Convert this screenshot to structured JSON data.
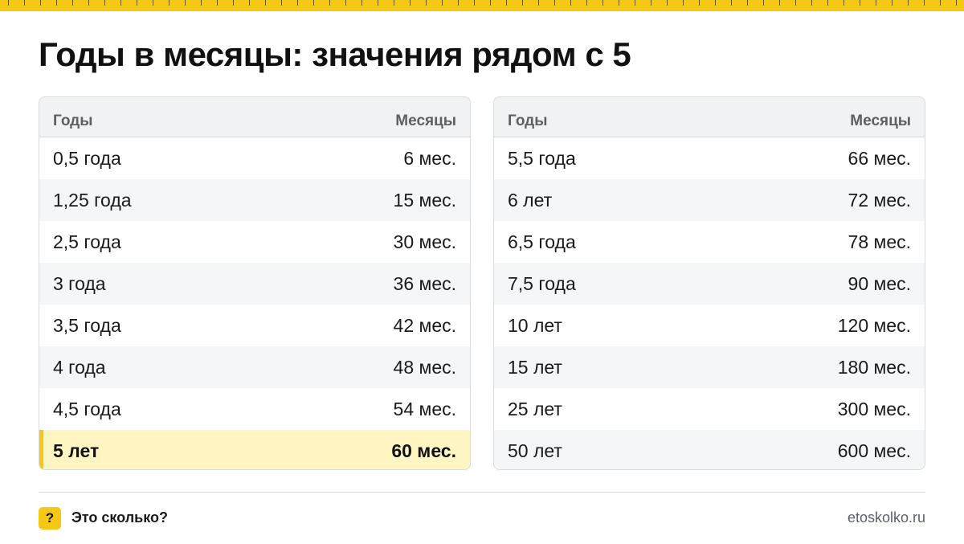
{
  "title": "Годы в месяцы: значения рядом с 5",
  "colors": {
    "accent": "#f5c816",
    "highlight_bg": "#fff5c2",
    "header_bg": "#f1f2f4"
  },
  "tables": [
    {
      "headers": {
        "years": "Годы",
        "months": "Месяцы"
      },
      "rows": [
        {
          "years": "0,5 года",
          "months": "6 мес."
        },
        {
          "years": "1,25 года",
          "months": "15 мес."
        },
        {
          "years": "2,5 года",
          "months": "30 мес."
        },
        {
          "years": "3 года",
          "months": "36 мес."
        },
        {
          "years": "3,5 года",
          "months": "42 мес."
        },
        {
          "years": "4 года",
          "months": "48 мес."
        },
        {
          "years": "4,5 года",
          "months": "54 мес."
        },
        {
          "years": "5 лет",
          "months": "60 мес.",
          "highlighted": true
        }
      ]
    },
    {
      "headers": {
        "years": "Годы",
        "months": "Месяцы"
      },
      "rows": [
        {
          "years": "5,5 года",
          "months": "66 мес."
        },
        {
          "years": "6 лет",
          "months": "72 мес."
        },
        {
          "years": "6,5 года",
          "months": "78 мес."
        },
        {
          "years": "7,5 года",
          "months": "90 мес."
        },
        {
          "years": "10 лет",
          "months": "120 мес."
        },
        {
          "years": "15 лет",
          "months": "180 мес."
        },
        {
          "years": "25 лет",
          "months": "300 мес."
        },
        {
          "years": "50 лет",
          "months": "600 мес."
        }
      ]
    }
  ],
  "footer": {
    "badge": "?",
    "brand": "Это сколько?",
    "url": "etoskolko.ru"
  }
}
